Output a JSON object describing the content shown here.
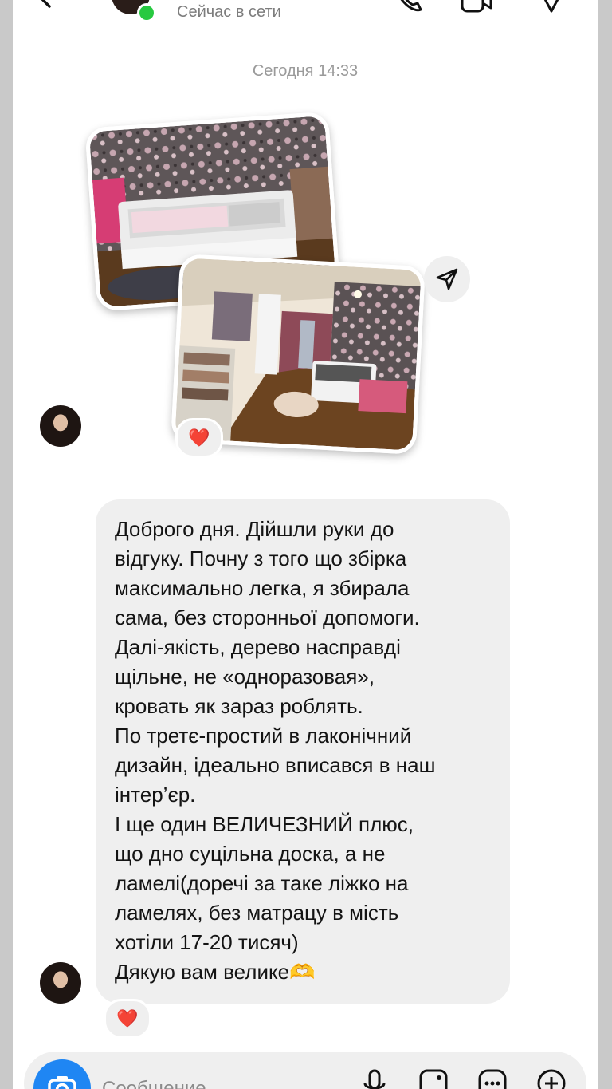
{
  "header": {
    "status": "Сейчас в сети",
    "icons": [
      "back-arrow-icon",
      "phone-icon",
      "video-icon",
      "tag-icon"
    ]
  },
  "conversation": {
    "timestamp": "Сегодня 14:33",
    "photo_reaction": "❤️",
    "message_reaction": "❤️",
    "message_lines": [
      "Доброго дня. Дійшли руки до",
      "відгуку. Почну з того що збірка",
      "максимально легка, я збирала",
      "сама, без сторонньої допомоги.",
      "Далі-якість, дерево насправді",
      "щільне, не «одноразовая»,",
      "кровать як зараз роблять.",
      "По третє-простий в лаконічний",
      "дизайн, ідеально вписався в наш",
      "інтер’єр.",
      "І ще один ВЕЛИЧЕЗНИЙ плюс,",
      "що дно суцільна доска, а не",
      "ламелі(доречі за таке ліжко на",
      "ламелях, без матрацу в мість",
      "хотіли 17-20 тисяч)",
      "Дякую вам велике🫶"
    ]
  },
  "composer": {
    "placeholder": "Сообщение",
    "icons": [
      "camera-icon",
      "microphone-icon",
      "gallery-icon",
      "sticker-icon",
      "plus-icon"
    ]
  },
  "colors": {
    "accent": "#1f86f3",
    "online": "#27c940",
    "bubble": "#efefef",
    "heart": "#e8242f"
  }
}
